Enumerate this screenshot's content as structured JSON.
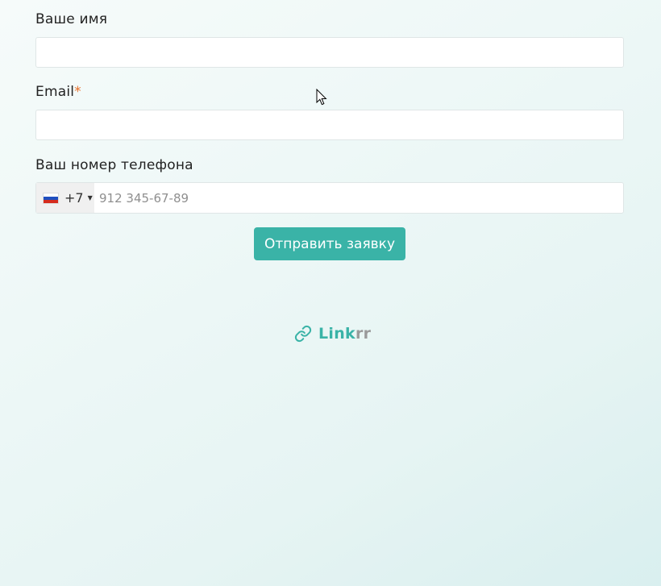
{
  "form": {
    "name_label": "Ваше имя",
    "name_value": "",
    "email_label": "Email",
    "email_required_mark": "*",
    "email_value": "",
    "phone_label": "Ваш номер телефона",
    "phone_country_flag": "ru-flag-icon",
    "phone_dial_code": "+7",
    "phone_placeholder": "912 345-67-89",
    "phone_value": "",
    "submit_label": "Отправить заявку"
  },
  "brand": {
    "icon": "link-icon",
    "name_part1": "Link",
    "name_part2": "rr"
  },
  "colors": {
    "accent": "#3ab3a7",
    "required": "#e8712b",
    "brand_secondary": "#9a9a9a"
  }
}
